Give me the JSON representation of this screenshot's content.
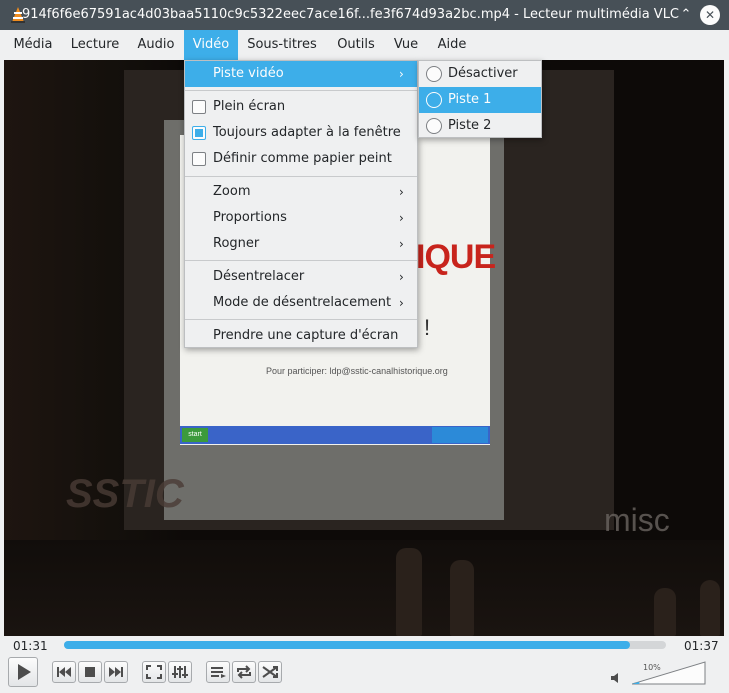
{
  "window": {
    "title": "914f6f6e67591ac4d03baa5110c9c5322eec7ace16f...fe3f674d93a2bc.mp4 - Lecteur multimédia VLC",
    "minimize_glyph": "⌃",
    "close_glyph": "✕"
  },
  "menubar": {
    "items": [
      {
        "label": "Média"
      },
      {
        "label": "Lecture"
      },
      {
        "label": "Audio"
      },
      {
        "label": "Vidéo"
      },
      {
        "label": "Sous-titres"
      },
      {
        "label": "Outils"
      },
      {
        "label": "Vue"
      },
      {
        "label": "Aide"
      }
    ],
    "active": "Vidéo"
  },
  "video_menu": {
    "items": [
      {
        "label": "Piste vidéo",
        "submenu": true,
        "highlighted": true
      },
      {
        "label": "Plein écran",
        "checkbox": true,
        "checked": false
      },
      {
        "label": "Toujours adapter à la fenêtre",
        "checkbox": true,
        "checked": true
      },
      {
        "label": "Définir comme papier peint",
        "checkbox": true,
        "checked": false
      },
      {
        "label": "Zoom",
        "submenu": true
      },
      {
        "label": "Proportions",
        "submenu": true
      },
      {
        "label": "Rogner",
        "submenu": true
      },
      {
        "label": "Désentrelacer",
        "submenu": true
      },
      {
        "label": "Mode de désentrelacement",
        "submenu": true
      },
      {
        "label": "Prendre une capture d'écran"
      }
    ],
    "arrow_glyph": "›"
  },
  "video_track_submenu": {
    "items": [
      {
        "label": "Désactiver"
      },
      {
        "label": "Piste 1",
        "highlighted": true
      },
      {
        "label": "Piste 2"
      }
    ]
  },
  "video_frame": {
    "slide_text": "IQUE",
    "slide_exclamation": "!",
    "slide_participer": "Pour participer: ldp@sstic-canalhistorique.org",
    "taskbar_start": "start",
    "logo_left": "SSTIC",
    "logo_right": "misc"
  },
  "playback": {
    "elapsed": "01:31",
    "total": "01:37",
    "progress": 0.94,
    "volume_label": "10%",
    "volume": 0.1
  },
  "theme": {
    "accent": "#3daee9",
    "titlebar": "#475057",
    "background": "#eff0f1"
  }
}
